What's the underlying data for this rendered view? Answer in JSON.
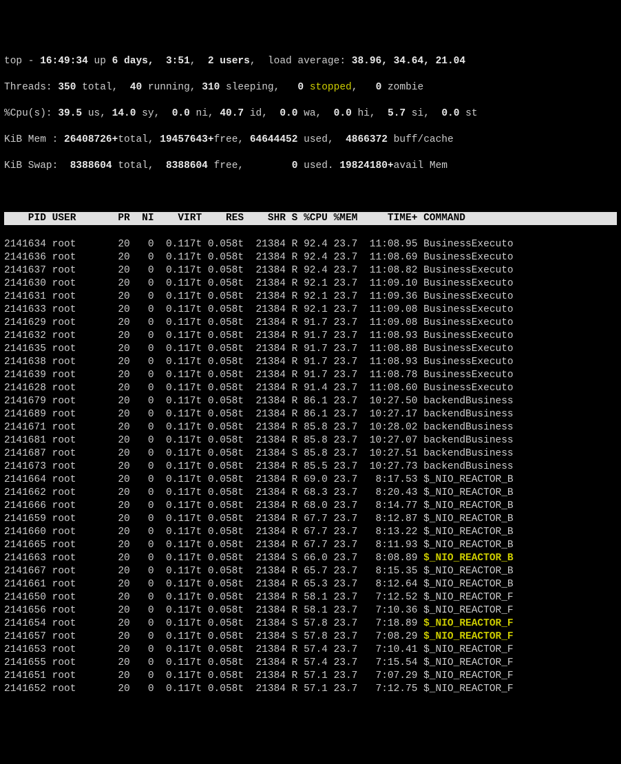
{
  "summary": {
    "line1": {
      "prefix": "top - ",
      "time": "16:49:34",
      "up_label": " up ",
      "uptime": "6 days,  3:51",
      "users_sep": ",  ",
      "users": "2 users",
      "load_label": ",  load average: ",
      "loads": "38.96, 34.64, 21.04"
    },
    "threads": {
      "label": "Threads: ",
      "total": "350",
      "total_lbl": " total,  ",
      "running": "40",
      "running_lbl": " running, ",
      "sleeping": "310",
      "sleeping_lbl": " sleeping,   ",
      "stopped": "0",
      "stopped_lbl_a": " ",
      "stopped_word": "stopped",
      "zombie_sep": ",   ",
      "zombie": "0",
      "zombie_lbl": " zombie"
    },
    "cpu": {
      "label": "%Cpu(s): ",
      "us": "39.5",
      "us_lbl": " us, ",
      "sy": "14.0",
      "sy_lbl": " sy,  ",
      "ni": "0.0",
      "ni_lbl": " ni, ",
      "id": "40.7",
      "id_lbl": " id,  ",
      "wa": "0.0",
      "wa_lbl": " wa,  ",
      "hi": "0.0",
      "hi_lbl": " hi,  ",
      "si": "5.7",
      "si_lbl": " si,  ",
      "st": "0.0",
      "st_lbl": " st"
    },
    "mem": {
      "label": "KiB Mem : ",
      "total": "26408726+",
      "total_lbl": "total, ",
      "free": "19457643+",
      "free_lbl": "free, ",
      "used": "64644452",
      "used_lbl": " used,  ",
      "cache": "4866372",
      "cache_lbl": " buff/cache"
    },
    "swap": {
      "label": "KiB Swap:  ",
      "total": "8388604",
      "total_lbl": " total,  ",
      "free": "8388604",
      "free_lbl": " free,        ",
      "used": "0",
      "used_lbl": " used. ",
      "avail": "19824180+",
      "avail_lbl": "avail Mem"
    }
  },
  "columns": {
    "pid": "PID",
    "user": "USER",
    "pr": "PR",
    "ni": "NI",
    "virt": "VIRT",
    "res": "RES",
    "shr": "SHR",
    "s": "S",
    "cpu": "%CPU",
    "mem": "%MEM",
    "time": "TIME+",
    "cmd": "COMMAND"
  },
  "rows": [
    {
      "pid": "2141634",
      "user": "root",
      "pr": "20",
      "ni": "0",
      "virt": "0.117t",
      "res": "0.058t",
      "shr": "21384",
      "s": "R",
      "cpu": "92.4",
      "mem": "23.7",
      "time": "11:08.95",
      "cmd": "BusinessExecuto",
      "hl": false
    },
    {
      "pid": "2141636",
      "user": "root",
      "pr": "20",
      "ni": "0",
      "virt": "0.117t",
      "res": "0.058t",
      "shr": "21384",
      "s": "R",
      "cpu": "92.4",
      "mem": "23.7",
      "time": "11:08.69",
      "cmd": "BusinessExecuto",
      "hl": false
    },
    {
      "pid": "2141637",
      "user": "root",
      "pr": "20",
      "ni": "0",
      "virt": "0.117t",
      "res": "0.058t",
      "shr": "21384",
      "s": "R",
      "cpu": "92.4",
      "mem": "23.7",
      "time": "11:08.82",
      "cmd": "BusinessExecuto",
      "hl": false
    },
    {
      "pid": "2141630",
      "user": "root",
      "pr": "20",
      "ni": "0",
      "virt": "0.117t",
      "res": "0.058t",
      "shr": "21384",
      "s": "R",
      "cpu": "92.1",
      "mem": "23.7",
      "time": "11:09.10",
      "cmd": "BusinessExecuto",
      "hl": false
    },
    {
      "pid": "2141631",
      "user": "root",
      "pr": "20",
      "ni": "0",
      "virt": "0.117t",
      "res": "0.058t",
      "shr": "21384",
      "s": "R",
      "cpu": "92.1",
      "mem": "23.7",
      "time": "11:09.36",
      "cmd": "BusinessExecuto",
      "hl": false
    },
    {
      "pid": "2141633",
      "user": "root",
      "pr": "20",
      "ni": "0",
      "virt": "0.117t",
      "res": "0.058t",
      "shr": "21384",
      "s": "R",
      "cpu": "92.1",
      "mem": "23.7",
      "time": "11:09.08",
      "cmd": "BusinessExecuto",
      "hl": false
    },
    {
      "pid": "2141629",
      "user": "root",
      "pr": "20",
      "ni": "0",
      "virt": "0.117t",
      "res": "0.058t",
      "shr": "21384",
      "s": "R",
      "cpu": "91.7",
      "mem": "23.7",
      "time": "11:09.08",
      "cmd": "BusinessExecuto",
      "hl": false
    },
    {
      "pid": "2141632",
      "user": "root",
      "pr": "20",
      "ni": "0",
      "virt": "0.117t",
      "res": "0.058t",
      "shr": "21384",
      "s": "R",
      "cpu": "91.7",
      "mem": "23.7",
      "time": "11:08.93",
      "cmd": "BusinessExecuto",
      "hl": false
    },
    {
      "pid": "2141635",
      "user": "root",
      "pr": "20",
      "ni": "0",
      "virt": "0.117t",
      "res": "0.058t",
      "shr": "21384",
      "s": "R",
      "cpu": "91.7",
      "mem": "23.7",
      "time": "11:08.88",
      "cmd": "BusinessExecuto",
      "hl": false
    },
    {
      "pid": "2141638",
      "user": "root",
      "pr": "20",
      "ni": "0",
      "virt": "0.117t",
      "res": "0.058t",
      "shr": "21384",
      "s": "R",
      "cpu": "91.7",
      "mem": "23.7",
      "time": "11:08.93",
      "cmd": "BusinessExecuto",
      "hl": false
    },
    {
      "pid": "2141639",
      "user": "root",
      "pr": "20",
      "ni": "0",
      "virt": "0.117t",
      "res": "0.058t",
      "shr": "21384",
      "s": "R",
      "cpu": "91.7",
      "mem": "23.7",
      "time": "11:08.78",
      "cmd": "BusinessExecuto",
      "hl": false
    },
    {
      "pid": "2141628",
      "user": "root",
      "pr": "20",
      "ni": "0",
      "virt": "0.117t",
      "res": "0.058t",
      "shr": "21384",
      "s": "R",
      "cpu": "91.4",
      "mem": "23.7",
      "time": "11:08.60",
      "cmd": "BusinessExecuto",
      "hl": false
    },
    {
      "pid": "2141679",
      "user": "root",
      "pr": "20",
      "ni": "0",
      "virt": "0.117t",
      "res": "0.058t",
      "shr": "21384",
      "s": "R",
      "cpu": "86.1",
      "mem": "23.7",
      "time": "10:27.50",
      "cmd": "backendBusiness",
      "hl": false
    },
    {
      "pid": "2141689",
      "user": "root",
      "pr": "20",
      "ni": "0",
      "virt": "0.117t",
      "res": "0.058t",
      "shr": "21384",
      "s": "R",
      "cpu": "86.1",
      "mem": "23.7",
      "time": "10:27.17",
      "cmd": "backendBusiness",
      "hl": false
    },
    {
      "pid": "2141671",
      "user": "root",
      "pr": "20",
      "ni": "0",
      "virt": "0.117t",
      "res": "0.058t",
      "shr": "21384",
      "s": "R",
      "cpu": "85.8",
      "mem": "23.7",
      "time": "10:28.02",
      "cmd": "backendBusiness",
      "hl": false
    },
    {
      "pid": "2141681",
      "user": "root",
      "pr": "20",
      "ni": "0",
      "virt": "0.117t",
      "res": "0.058t",
      "shr": "21384",
      "s": "R",
      "cpu": "85.8",
      "mem": "23.7",
      "time": "10:27.07",
      "cmd": "backendBusiness",
      "hl": false
    },
    {
      "pid": "2141687",
      "user": "root",
      "pr": "20",
      "ni": "0",
      "virt": "0.117t",
      "res": "0.058t",
      "shr": "21384",
      "s": "S",
      "cpu": "85.8",
      "mem": "23.7",
      "time": "10:27.51",
      "cmd": "backendBusiness",
      "hl": false
    },
    {
      "pid": "2141673",
      "user": "root",
      "pr": "20",
      "ni": "0",
      "virt": "0.117t",
      "res": "0.058t",
      "shr": "21384",
      "s": "R",
      "cpu": "85.5",
      "mem": "23.7",
      "time": "10:27.73",
      "cmd": "backendBusiness",
      "hl": false
    },
    {
      "pid": "2141664",
      "user": "root",
      "pr": "20",
      "ni": "0",
      "virt": "0.117t",
      "res": "0.058t",
      "shr": "21384",
      "s": "R",
      "cpu": "69.0",
      "mem": "23.7",
      "time": "8:17.53",
      "cmd": "$_NIO_REACTOR_B",
      "hl": false
    },
    {
      "pid": "2141662",
      "user": "root",
      "pr": "20",
      "ni": "0",
      "virt": "0.117t",
      "res": "0.058t",
      "shr": "21384",
      "s": "R",
      "cpu": "68.3",
      "mem": "23.7",
      "time": "8:20.43",
      "cmd": "$_NIO_REACTOR_B",
      "hl": false
    },
    {
      "pid": "2141666",
      "user": "root",
      "pr": "20",
      "ni": "0",
      "virt": "0.117t",
      "res": "0.058t",
      "shr": "21384",
      "s": "R",
      "cpu": "68.0",
      "mem": "23.7",
      "time": "8:14.77",
      "cmd": "$_NIO_REACTOR_B",
      "hl": false
    },
    {
      "pid": "2141659",
      "user": "root",
      "pr": "20",
      "ni": "0",
      "virt": "0.117t",
      "res": "0.058t",
      "shr": "21384",
      "s": "R",
      "cpu": "67.7",
      "mem": "23.7",
      "time": "8:12.87",
      "cmd": "$_NIO_REACTOR_B",
      "hl": false
    },
    {
      "pid": "2141660",
      "user": "root",
      "pr": "20",
      "ni": "0",
      "virt": "0.117t",
      "res": "0.058t",
      "shr": "21384",
      "s": "R",
      "cpu": "67.7",
      "mem": "23.7",
      "time": "8:13.22",
      "cmd": "$_NIO_REACTOR_B",
      "hl": false
    },
    {
      "pid": "2141665",
      "user": "root",
      "pr": "20",
      "ni": "0",
      "virt": "0.117t",
      "res": "0.058t",
      "shr": "21384",
      "s": "R",
      "cpu": "67.7",
      "mem": "23.7",
      "time": "8:11.93",
      "cmd": "$_NIO_REACTOR_B",
      "hl": false
    },
    {
      "pid": "2141663",
      "user": "root",
      "pr": "20",
      "ni": "0",
      "virt": "0.117t",
      "res": "0.058t",
      "shr": "21384",
      "s": "S",
      "cpu": "66.0",
      "mem": "23.7",
      "time": "8:08.89",
      "cmd": "$_NIO_REACTOR_B",
      "hl": true
    },
    {
      "pid": "2141667",
      "user": "root",
      "pr": "20",
      "ni": "0",
      "virt": "0.117t",
      "res": "0.058t",
      "shr": "21384",
      "s": "R",
      "cpu": "65.7",
      "mem": "23.7",
      "time": "8:15.35",
      "cmd": "$_NIO_REACTOR_B",
      "hl": false
    },
    {
      "pid": "2141661",
      "user": "root",
      "pr": "20",
      "ni": "0",
      "virt": "0.117t",
      "res": "0.058t",
      "shr": "21384",
      "s": "R",
      "cpu": "65.3",
      "mem": "23.7",
      "time": "8:12.64",
      "cmd": "$_NIO_REACTOR_B",
      "hl": false
    },
    {
      "pid": "2141650",
      "user": "root",
      "pr": "20",
      "ni": "0",
      "virt": "0.117t",
      "res": "0.058t",
      "shr": "21384",
      "s": "R",
      "cpu": "58.1",
      "mem": "23.7",
      "time": "7:12.52",
      "cmd": "$_NIO_REACTOR_F",
      "hl": false
    },
    {
      "pid": "2141656",
      "user": "root",
      "pr": "20",
      "ni": "0",
      "virt": "0.117t",
      "res": "0.058t",
      "shr": "21384",
      "s": "R",
      "cpu": "58.1",
      "mem": "23.7",
      "time": "7:10.36",
      "cmd": "$_NIO_REACTOR_F",
      "hl": false
    },
    {
      "pid": "2141654",
      "user": "root",
      "pr": "20",
      "ni": "0",
      "virt": "0.117t",
      "res": "0.058t",
      "shr": "21384",
      "s": "S",
      "cpu": "57.8",
      "mem": "23.7",
      "time": "7:18.89",
      "cmd": "$_NIO_REACTOR_F",
      "hl": true
    },
    {
      "pid": "2141657",
      "user": "root",
      "pr": "20",
      "ni": "0",
      "virt": "0.117t",
      "res": "0.058t",
      "shr": "21384",
      "s": "S",
      "cpu": "57.8",
      "mem": "23.7",
      "time": "7:08.29",
      "cmd": "$_NIO_REACTOR_F",
      "hl": true
    },
    {
      "pid": "2141653",
      "user": "root",
      "pr": "20",
      "ni": "0",
      "virt": "0.117t",
      "res": "0.058t",
      "shr": "21384",
      "s": "R",
      "cpu": "57.4",
      "mem": "23.7",
      "time": "7:10.41",
      "cmd": "$_NIO_REACTOR_F",
      "hl": false
    },
    {
      "pid": "2141655",
      "user": "root",
      "pr": "20",
      "ni": "0",
      "virt": "0.117t",
      "res": "0.058t",
      "shr": "21384",
      "s": "R",
      "cpu": "57.4",
      "mem": "23.7",
      "time": "7:15.54",
      "cmd": "$_NIO_REACTOR_F",
      "hl": false
    },
    {
      "pid": "2141651",
      "user": "root",
      "pr": "20",
      "ni": "0",
      "virt": "0.117t",
      "res": "0.058t",
      "shr": "21384",
      "s": "R",
      "cpu": "57.1",
      "mem": "23.7",
      "time": "7:07.29",
      "cmd": "$_NIO_REACTOR_F",
      "hl": false
    },
    {
      "pid": "2141652",
      "user": "root",
      "pr": "20",
      "ni": "0",
      "virt": "0.117t",
      "res": "0.058t",
      "shr": "21384",
      "s": "R",
      "cpu": "57.1",
      "mem": "23.7",
      "time": "7:12.75",
      "cmd": "$_NIO_REACTOR_F",
      "hl": false
    }
  ]
}
